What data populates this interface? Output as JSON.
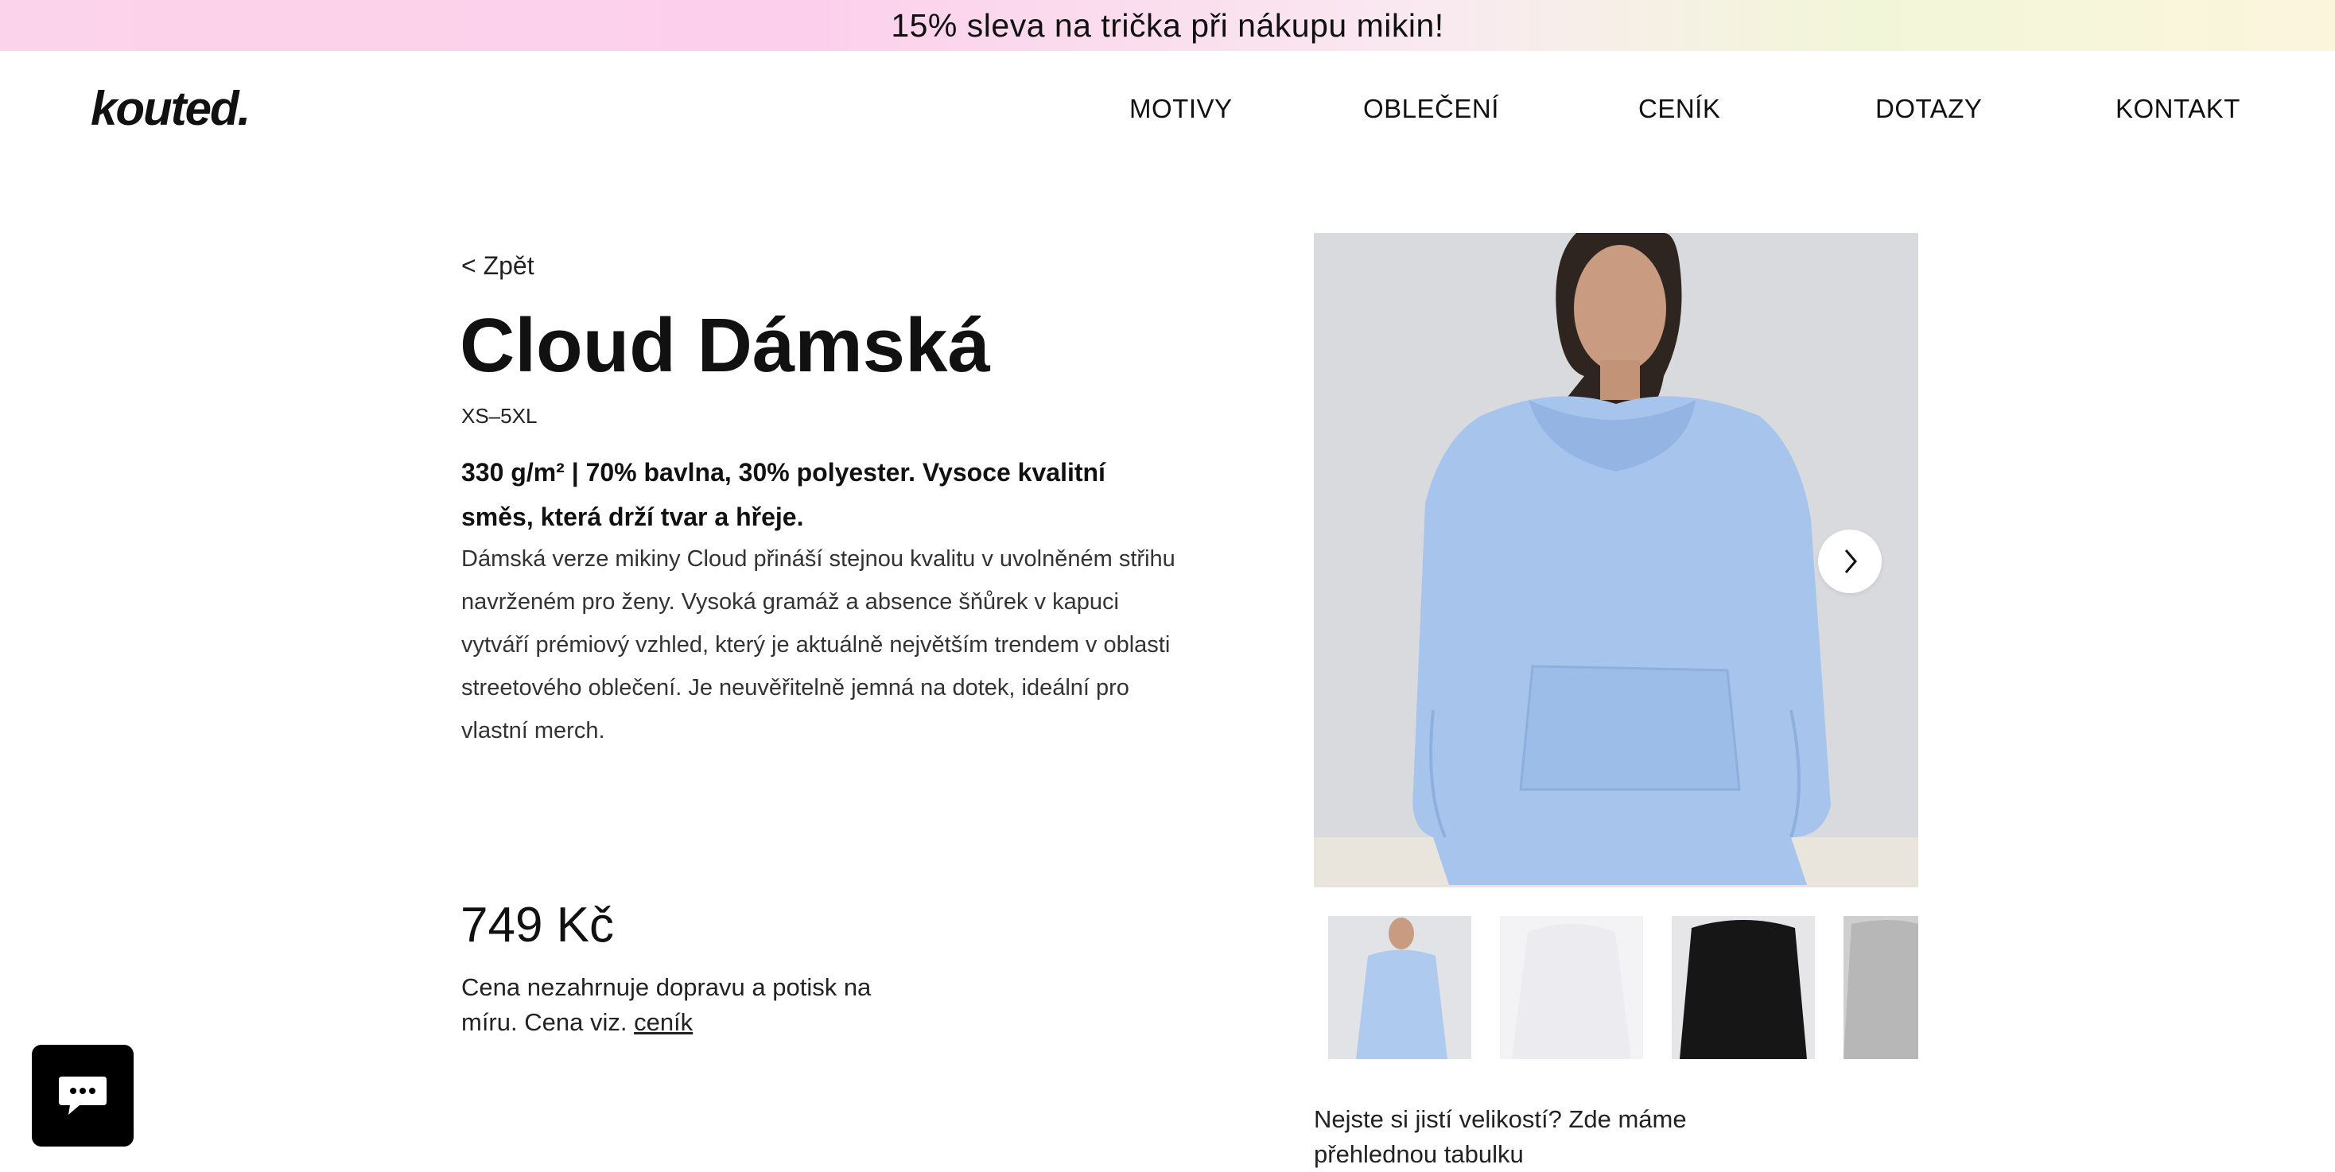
{
  "promo": {
    "text": "15% sleva na trička při nákupu mikin!"
  },
  "header": {
    "logo": "kouted.",
    "nav": [
      {
        "label": "MOTIVY"
      },
      {
        "label": "OBLEČENÍ"
      },
      {
        "label": "CENÍK"
      },
      {
        "label": "DOTAZY"
      },
      {
        "label": "KONTAKT"
      }
    ]
  },
  "product": {
    "back_label": "< Zpět",
    "title": "Cloud Dámská",
    "sizes": "XS–5XL",
    "lead": "330 g/m² | 70% bavlna, 30% polyester. Vysoce kvalitní směs, která drží tvar a hřeje.",
    "description": "Dámská verze mikiny Cloud přináší stejnou kvalitu v uvolněném střihu navrženém pro ženy. Vysoká gramáž a absence šňůrek v kapuci vytváří prémiový vzhled, který je aktuálně největším trendem v oblasti streetového oblečení. Je neuvěřitelně jemná na dotek, ideální pro vlastní merch.",
    "price": "749 Kč",
    "price_note": "Cena nezahrnuje dopravu a potisk na míru. Cena viz.",
    "price_link": "ceník",
    "size_note": "Nejste si jistí velikostí? Zde máme přehlednou tabulku"
  },
  "gallery": {
    "thumbnails": [
      {
        "color": "#aecbef",
        "bg": "#e2e3e7"
      },
      {
        "color": "#ecebf0",
        "bg": "#f3f3f5"
      },
      {
        "color": "#161616",
        "bg": "#e6e6e8"
      },
      {
        "color": "#b7b7b7",
        "bg": "#cfcfcf"
      }
    ],
    "hoodie_color": "#a6c4ec"
  }
}
